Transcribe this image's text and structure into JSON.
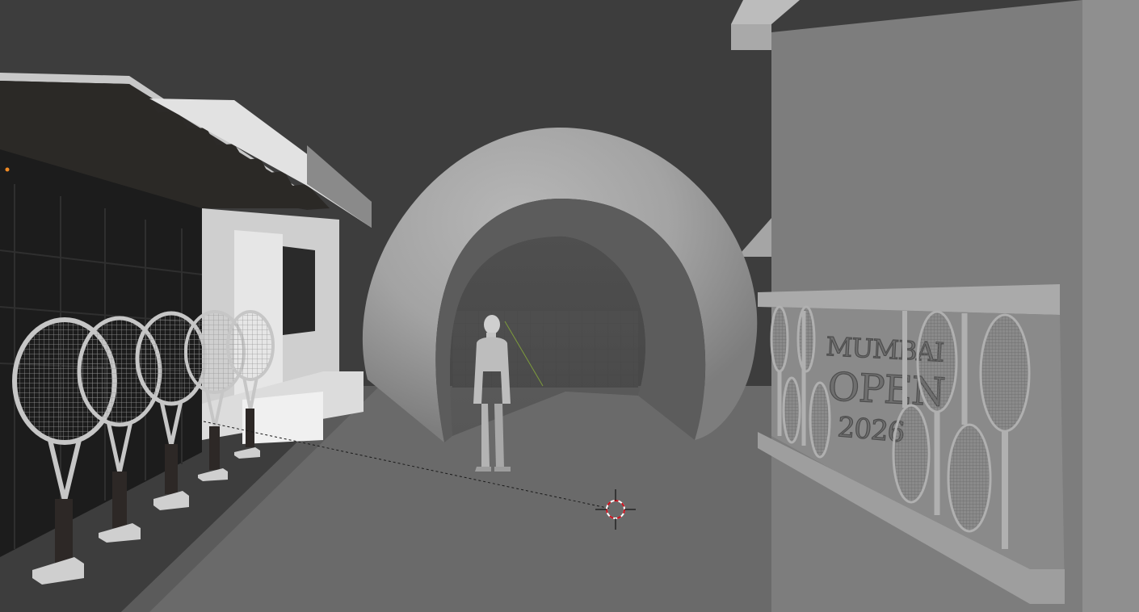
{
  "viewport": {
    "background_color": "#3d3d3d",
    "floor_color": "#6b6b6b",
    "object_color": "#8c8c8c",
    "dark_object_color": "#1e1e1e"
  },
  "sign": {
    "line1": "MUMBAI",
    "line2": "OPEN",
    "line3": "2026"
  },
  "cursor": {
    "name": "3d-cursor",
    "color": "#d0101c"
  }
}
